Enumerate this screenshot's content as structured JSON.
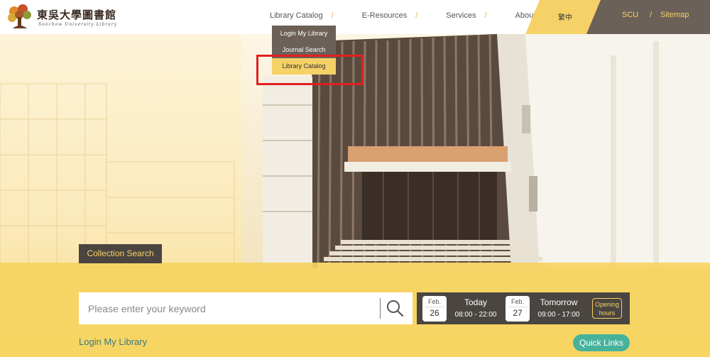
{
  "logo": {
    "text": "東吳大學圖書館",
    "sub": "Soochow University Library"
  },
  "nav": [
    {
      "label": "Library Catalog"
    },
    {
      "label": "E-Resources"
    },
    {
      "label": "Services"
    },
    {
      "label": "About Us"
    }
  ],
  "lang": {
    "label": "繁中"
  },
  "top_links": {
    "scu": "SCU",
    "sep": "/",
    "sitemap": "Sitemap"
  },
  "dropdown": {
    "items": [
      {
        "label": "Login My Library"
      },
      {
        "label": "Journal Search"
      },
      {
        "label": "Library Catalog"
      }
    ],
    "active_index": 2
  },
  "search": {
    "tab_label": "Collection Search",
    "placeholder": "Please enter your keyword"
  },
  "hours": {
    "today": {
      "month": "Feb.",
      "day": "26",
      "label": "Today",
      "time": "08:00 - 22:00"
    },
    "tomorrow": {
      "month": "Feb.",
      "day": "27",
      "label": "Tomorrow",
      "time": "09:00 - 17:00"
    },
    "opening_label_line1": "Opening",
    "opening_label_line2": "hours"
  },
  "footer": {
    "login_label": "Login My Library",
    "quick_links_label": "Quick Links"
  },
  "colors": {
    "accent_yellow": "#f5d168",
    "dark_panel": "#4a4540",
    "header_gray": "#6b6158",
    "quick_links_green": "#46b29a",
    "highlight_red": "#e02020"
  }
}
